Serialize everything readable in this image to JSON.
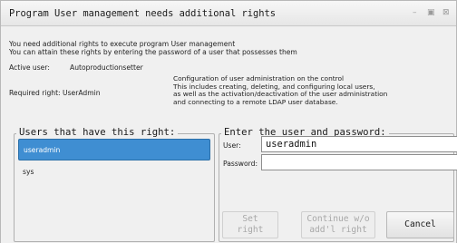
{
  "window": {
    "title": "Program User management needs additional rights",
    "controls": {
      "minimize": "–",
      "maximize": "▣",
      "close": "⊠"
    }
  },
  "intro": {
    "line1": "You need additional rights to execute program User management",
    "line2": "You can attain these rights by entering the password of a user that possesses them"
  },
  "active_user": {
    "label": "Active user:",
    "value": "Autoproductionsetter"
  },
  "required_right": {
    "label": "Required right: UserAdmin",
    "description": [
      "Configuration of user administration on the control",
      "This includes creating, deleting, and configuring local users,",
      "as well as the activation/deactivation of the user administration",
      "and connecting to a remote LDAP user database."
    ]
  },
  "users_group": {
    "title": "Users that have this right:",
    "users": [
      {
        "name": "useradmin",
        "selected": true
      },
      {
        "name": "sys",
        "selected": false
      }
    ]
  },
  "login_group": {
    "title": "Enter the user and password:",
    "user_label": "User:",
    "user_value": "useradmin",
    "password_label": "Password:",
    "password_value": ""
  },
  "buttons": {
    "set_right": "Set\nright",
    "continue": "Continue w/o\nadd'l right",
    "cancel": "Cancel"
  }
}
